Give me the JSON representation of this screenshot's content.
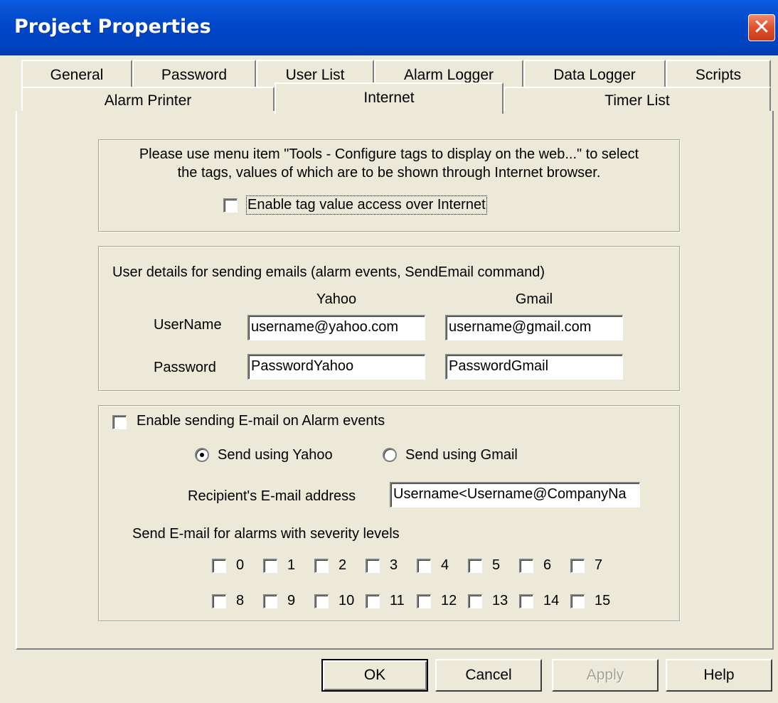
{
  "window": {
    "title": "Project Properties",
    "close_glyph": "✕"
  },
  "tabs": {
    "row1": [
      {
        "label": "General"
      },
      {
        "label": "Password"
      },
      {
        "label": "User List"
      },
      {
        "label": "Alarm Logger"
      },
      {
        "label": "Data Logger"
      },
      {
        "label": "Scripts"
      }
    ],
    "row2": [
      {
        "label": "Alarm Printer"
      },
      {
        "label": "Internet"
      },
      {
        "label": "Timer List"
      }
    ],
    "selected": "Internet"
  },
  "web": {
    "info_line1": "Please use menu item \"Tools - Configure tags to display on the web...\" to select",
    "info_line2": "the tags, values of which are to be shown through Internet browser.",
    "enable_label": "Enable tag value access over Internet",
    "enable_checked": false
  },
  "email_users": {
    "heading": "User details for sending emails (alarm events, SendEmail command)",
    "col_yahoo": "Yahoo",
    "col_gmail": "Gmail",
    "username_label": "UserName",
    "password_label": "Password",
    "yahoo_username": "username@yahoo.com",
    "gmail_username": "username@gmail.com",
    "yahoo_password": "PasswordYahoo",
    "gmail_password": "PasswordGmail"
  },
  "alarm_email": {
    "enable_label": "Enable sending E-mail on Alarm events",
    "enable_checked": false,
    "send_yahoo_label": "Send using Yahoo",
    "send_gmail_label": "Send using Gmail",
    "selected_provider": "Yahoo",
    "recipient_label": "Recipient's E-mail address",
    "recipient_value": "Username<Username@CompanyNa",
    "severity_label": "Send E-mail for alarms with severity levels",
    "severity_row1": [
      "0",
      "1",
      "2",
      "3",
      "4",
      "5",
      "6",
      "7"
    ],
    "severity_row2": [
      "8",
      "9",
      "10",
      "11",
      "12",
      "13",
      "14",
      "15"
    ]
  },
  "buttons": {
    "ok": "OK",
    "cancel": "Cancel",
    "apply": "Apply",
    "help": "Help"
  },
  "icons": {
    "close": "close-icon",
    "checkbox": "checkbox",
    "radio": "radio-button"
  }
}
